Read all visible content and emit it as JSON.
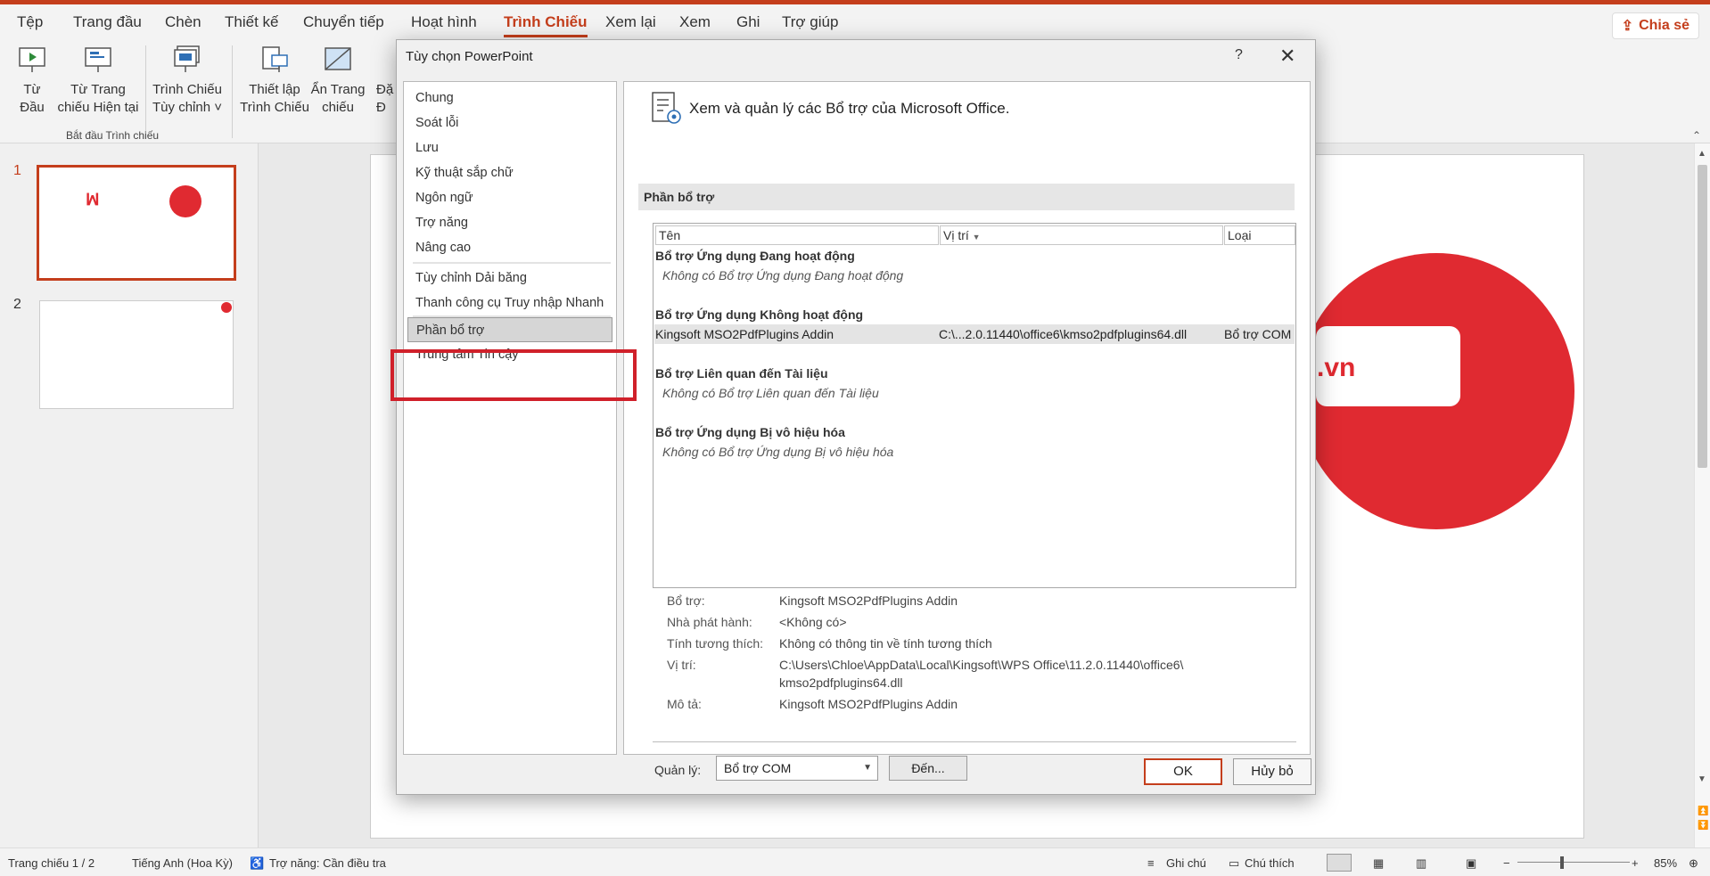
{
  "ribbon_tabs": [
    "Tệp",
    "Trang đầu",
    "Chèn",
    "Thiết kế",
    "Chuyển tiếp",
    "Hoạt hình",
    "Trình Chiếu",
    "Xem lại",
    "Xem",
    "Ghi",
    "Trợ giúp"
  ],
  "active_tab": "Trình Chiếu",
  "share_label": "Chia sẻ",
  "ribbon": {
    "from_start_line1": "Từ",
    "from_start_line2": "Đầu",
    "from_current_line1": "Từ Trang",
    "from_current_line2": "chiếu Hiện tại",
    "custom_show_line1": "Trình Chiếu",
    "custom_show_line2": "Tùy chỉnh ˅",
    "setup_line1": "Thiết lập",
    "setup_line2": "Trình Chiếu",
    "hide_line1": "Ẩn Trang",
    "hide_line2": "chiếu",
    "partial_line1": "Đặ",
    "partial_line2": "Đ",
    "group_label": "Bắt đầu Trình chiếu"
  },
  "slides": [
    {
      "number": "1"
    },
    {
      "number": "2"
    }
  ],
  "canvas": {
    "logo_text": ".vn"
  },
  "status_bar": {
    "slide_info": "Trang chiếu 1 / 2",
    "language": "Tiếng Anh (Hoa Kỳ)",
    "accessibility": "Trợ năng: Cần điều tra",
    "notes": "Ghi chú",
    "comments": "Chú thích",
    "zoom": "85%"
  },
  "dialog": {
    "title": "Tùy chọn PowerPoint",
    "help": "?",
    "close": "✕",
    "nav": [
      "Chung",
      "Soát lỗi",
      "Lưu",
      "Kỹ thuật sắp chữ",
      "Ngôn ngữ",
      "Trợ năng",
      "Nâng cao",
      "Tùy chỉnh Dải băng",
      "Thanh công cụ Truy nhập Nhanh",
      "Phần bổ trợ",
      "Trung tâm Tin cậy"
    ],
    "active_nav": "Phần bổ trợ",
    "header": "Xem và quản lý các Bổ trợ của Microsoft Office.",
    "section_title": "Phần bổ trợ",
    "columns": [
      "Tên",
      "Vị trí",
      "Loại"
    ],
    "groups": [
      {
        "title": "Bổ trợ Ứng dụng Đang hoạt động",
        "empty": "Không có Bổ trợ Ứng dụng Đang hoạt động"
      },
      {
        "title": "Bổ trợ Ứng dụng Không hoạt động",
        "row": {
          "name": "Kingsoft MSO2PdfPlugins Addin",
          "location": "C:\\...2.0.11440\\office6\\kmso2pdfplugins64.dll",
          "type": "Bổ trợ COM"
        }
      },
      {
        "title": "Bổ trợ Liên quan đến Tài liệu",
        "empty": "Không có Bổ trợ Liên quan đến Tài liệu"
      },
      {
        "title": "Bổ trợ Ứng dụng Bị vô hiệu hóa",
        "empty": "Không có Bổ trợ Ứng dụng Bị vô hiệu hóa"
      }
    ],
    "details": {
      "addin_label": "Bổ trợ:",
      "addin_value": "Kingsoft MSO2PdfPlugins Addin",
      "publisher_label": "Nhà phát hành:",
      "publisher_value": "<Không có>",
      "compat_label": "Tính tương thích:",
      "compat_value": "Không có thông tin về tính tương thích",
      "location_label": "Vị trí:",
      "location_value_line1": "C:\\Users\\Chloe\\AppData\\Local\\Kingsoft\\WPS Office\\11.2.0.11440\\office6\\",
      "location_value_line2": "kmso2pdfplugins64.dll",
      "desc_label": "Mô tả:",
      "desc_value": "Kingsoft MSO2PdfPlugins Addin"
    },
    "manage_label": "Quản lý:",
    "manage_value": "Bổ trợ COM",
    "go_label": "Đến...",
    "ok_label": "OK",
    "cancel_label": "Hủy bỏ"
  },
  "colors": {
    "accent": "#c43e1c",
    "highlight": "#d0202a",
    "brand_red": "#e02a31"
  }
}
